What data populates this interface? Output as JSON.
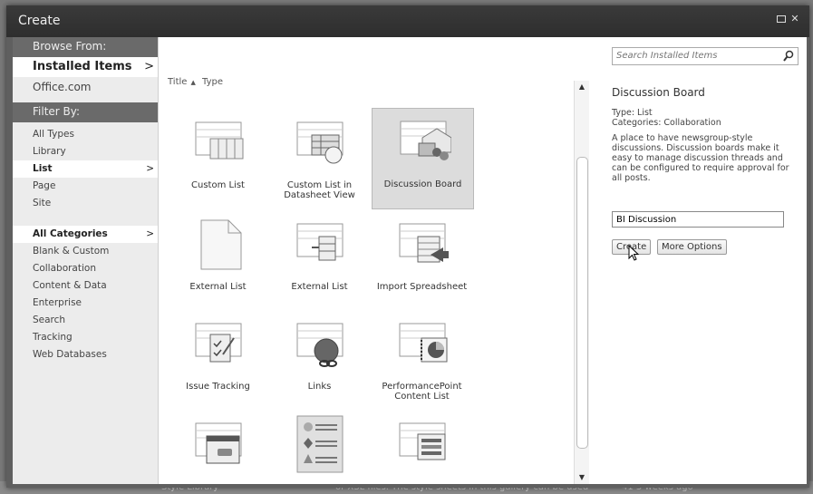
{
  "dialog": {
    "title": "Create"
  },
  "background": {
    "row_name": "Style Library",
    "row_desc": "or XSL files. The style sheets in this gallery can be used",
    "row_meta": "41  3 weeks ago"
  },
  "nav": {
    "browse_header": "Browse From:",
    "browse_items": [
      {
        "label": "Installed Items",
        "selected": true
      },
      {
        "label": "Office.com",
        "selected": false
      }
    ],
    "filter_header": "Filter By:",
    "types": [
      {
        "label": "All Types",
        "selected": false
      },
      {
        "label": "Library",
        "selected": false
      },
      {
        "label": "List",
        "selected": true
      },
      {
        "label": "Page",
        "selected": false
      },
      {
        "label": "Site",
        "selected": false
      }
    ],
    "categories": [
      {
        "label": "All Categories",
        "selected": true
      },
      {
        "label": "Blank & Custom",
        "selected": false
      },
      {
        "label": "Collaboration",
        "selected": false
      },
      {
        "label": "Content & Data",
        "selected": false
      },
      {
        "label": "Enterprise",
        "selected": false
      },
      {
        "label": "Search",
        "selected": false
      },
      {
        "label": "Tracking",
        "selected": false
      },
      {
        "label": "Web Databases",
        "selected": false
      }
    ],
    "chevron": ">"
  },
  "gallery": {
    "sort_title": "Title",
    "sort_arrow": "▲",
    "sort_type": "Type",
    "items": [
      {
        "label": "Custom List",
        "icon": "custom-list-icon"
      },
      {
        "label": "Custom List in Datasheet View",
        "icon": "datasheet-list-icon"
      },
      {
        "label": "Discussion Board",
        "icon": "discussion-board-icon",
        "selected": true
      },
      {
        "label": "External List",
        "icon": "external-list-page-icon"
      },
      {
        "label": "External List",
        "icon": "external-list-icon"
      },
      {
        "label": "Import Spreadsheet",
        "icon": "import-spreadsheet-icon"
      },
      {
        "label": "Issue Tracking",
        "icon": "issue-tracking-icon"
      },
      {
        "label": "Links",
        "icon": "links-icon"
      },
      {
        "label": "PerformancePoint Content List",
        "icon": "performancepoint-icon"
      },
      {
        "label": "",
        "icon": "calendar-list-icon"
      },
      {
        "label": "",
        "icon": "kpi-list-icon"
      },
      {
        "label": "",
        "icon": "task-list-icon"
      }
    ]
  },
  "details": {
    "search_placeholder": "Search Installed Items",
    "title": "Discussion Board",
    "type_line": "Type: List",
    "categories_line": "Categories: Collaboration",
    "description": "A place to have newsgroup-style discussions.  Discussion boards make it easy to manage discussion threads and can be configured to require approval for all posts.",
    "name_value": "BI Discussion",
    "create_label": "Create",
    "more_options_label": "More Options"
  }
}
